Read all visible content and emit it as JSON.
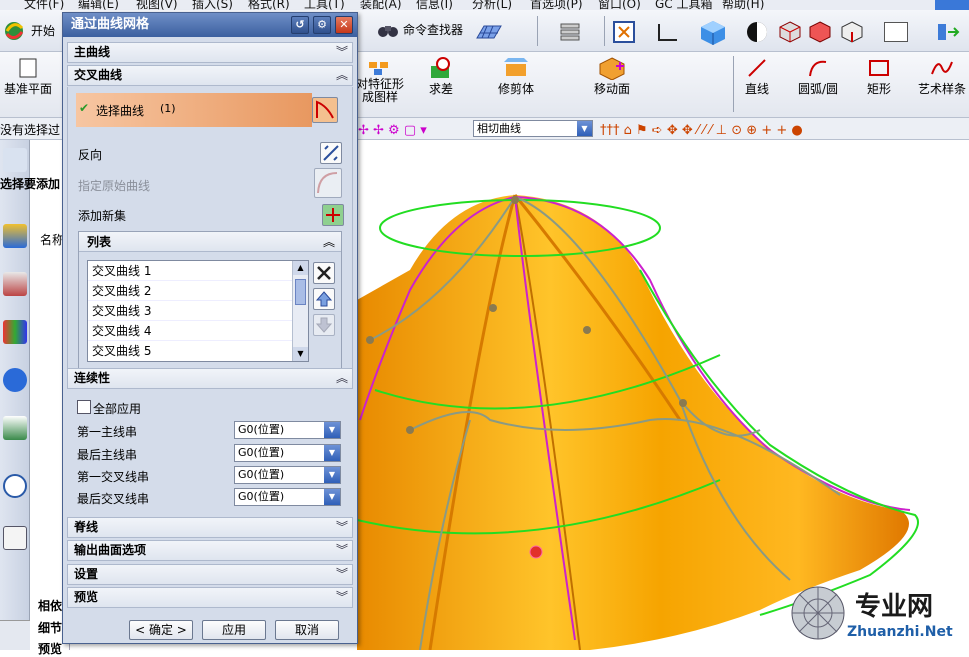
{
  "menu": [
    "文件(F)",
    "编辑(E)",
    "视图(V)",
    "插入(S)",
    "格式(R)",
    "工具(T)",
    "装配(A)",
    "信息(I)",
    "分析(L)",
    "首选项(P)",
    "窗口(O)",
    "GC 工具箱",
    "帮助(H)"
  ],
  "toolbar1": {
    "start": "开始",
    "command_finder": "命令查找器"
  },
  "toolbar2": {
    "datum_plane": "基准平面",
    "pattern_feature": "对特征形\n成图样",
    "subtract": "求差",
    "trim_body": "修剪体",
    "move_face": "移动面",
    "line": "直线",
    "arc": "圆弧/圆",
    "rectangle": "矩形",
    "studio_spline": "艺术样条"
  },
  "toolbar3": {
    "status": "没有选择过",
    "curve_rule": "相切曲线"
  },
  "status_prompt": "选择要添加",
  "nav": {
    "name_col": "名称",
    "related": "相依",
    "detail": "细节",
    "preview": "预览"
  },
  "dialog": {
    "title": "通过曲线网格",
    "sections": {
      "primary": "主曲线",
      "cross": "交叉曲线",
      "continuity": "连续性",
      "spine": "脊线",
      "output": "输出曲面选项",
      "settings": "设置",
      "preview": "预览"
    },
    "select_curve": "选择曲线",
    "select_count": "(1)",
    "reverse": "反向",
    "specify_origin": "指定原始曲线",
    "add_new_set": "添加新集",
    "list_header": "列表",
    "list_items": [
      "交叉曲线 1",
      "交叉曲线 2",
      "交叉曲线 3",
      "交叉曲线 4",
      "交叉曲线 5"
    ],
    "apply_all": "全部应用",
    "continuity_rows": [
      {
        "label": "第一主线串",
        "value": "G0(位置)"
      },
      {
        "label": "最后主线串",
        "value": "G0(位置)"
      },
      {
        "label": "第一交叉线串",
        "value": "G0(位置)"
      },
      {
        "label": "最后交叉线串",
        "value": "G0(位置)"
      }
    ],
    "ok": "< 确定 >",
    "apply": "应用",
    "cancel": "取消"
  },
  "watermark": {
    "title": "专业网",
    "url": "Zhuanzhi.Net"
  },
  "colors": {
    "title_bar": "#3b5f9f",
    "dialog_bg": "#d4dcea",
    "surface": "#f5a300",
    "green_curve": "#22dd22",
    "magenta_curve": "#cc22cc"
  }
}
